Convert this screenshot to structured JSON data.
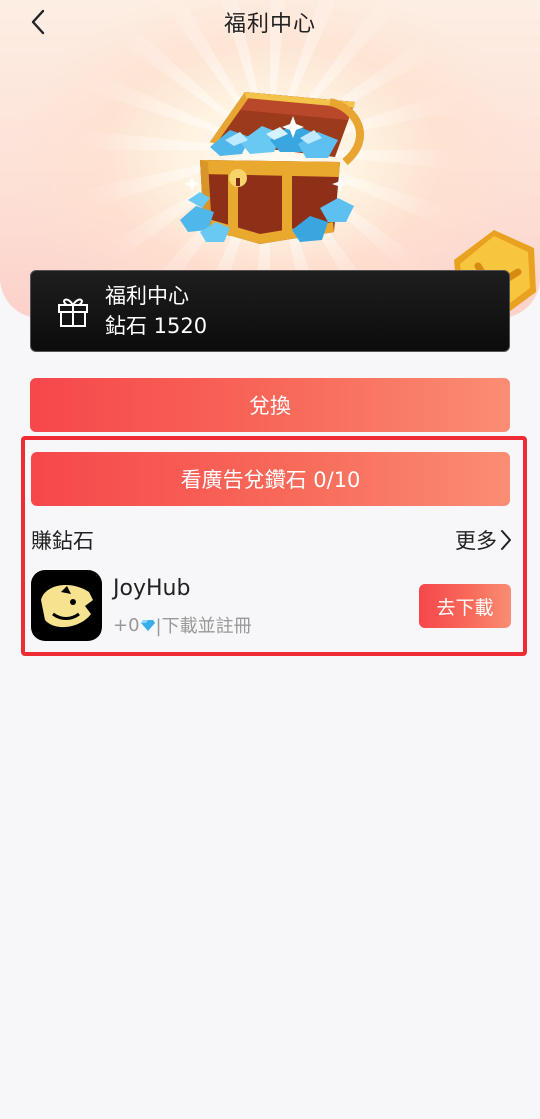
{
  "header": {
    "title": "福利中心"
  },
  "info_card": {
    "title": "福利中心",
    "balance": "鉆石 1520"
  },
  "exchange_button": "兌換",
  "ad_button": "看廣告兌鑽石 0/10",
  "earn_section": {
    "title": "賺鉆石",
    "more": "更多",
    "apps": [
      {
        "name": "JoyHub",
        "reward_prefix": "+0",
        "reward_suffix": "|下載並註冊",
        "action": "去下載"
      }
    ]
  },
  "colors": {
    "accent_start": "#f6474b",
    "accent_end": "#fa8d73",
    "highlight": "#ee2c34"
  }
}
